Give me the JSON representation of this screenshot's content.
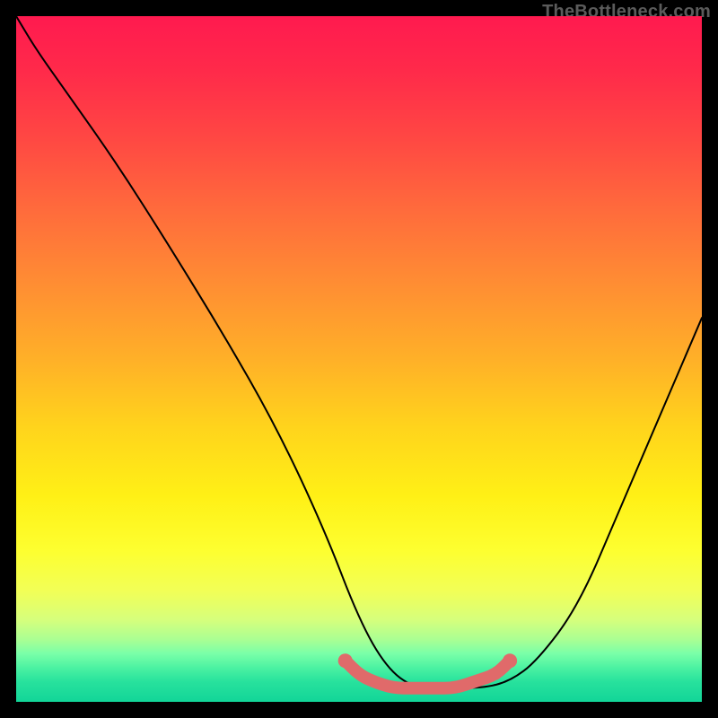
{
  "watermark": "TheBottleneck.com",
  "chart_data": {
    "type": "line",
    "title": "",
    "xlabel": "",
    "ylabel": "",
    "xlim": [
      0,
      100
    ],
    "ylim": [
      0,
      100
    ],
    "grid": false,
    "series": [
      {
        "name": "bottleneck-curve",
        "x": [
          0,
          3,
          8,
          15,
          22,
          30,
          38,
          45,
          50,
          54,
          58,
          62,
          68,
          72,
          76,
          82,
          88,
          94,
          100
        ],
        "y": [
          100,
          95,
          88,
          78,
          67,
          54,
          40,
          25,
          12,
          5,
          2,
          2,
          2,
          3,
          6,
          14,
          28,
          42,
          56
        ],
        "color": "#000000"
      },
      {
        "name": "optimal-range-marker",
        "x": [
          48,
          50,
          52,
          55,
          58,
          61,
          64,
          67,
          70,
          72
        ],
        "y": [
          6,
          4,
          3,
          2,
          2,
          2,
          2,
          3,
          4,
          6
        ],
        "color": "#e06a6a"
      }
    ]
  }
}
